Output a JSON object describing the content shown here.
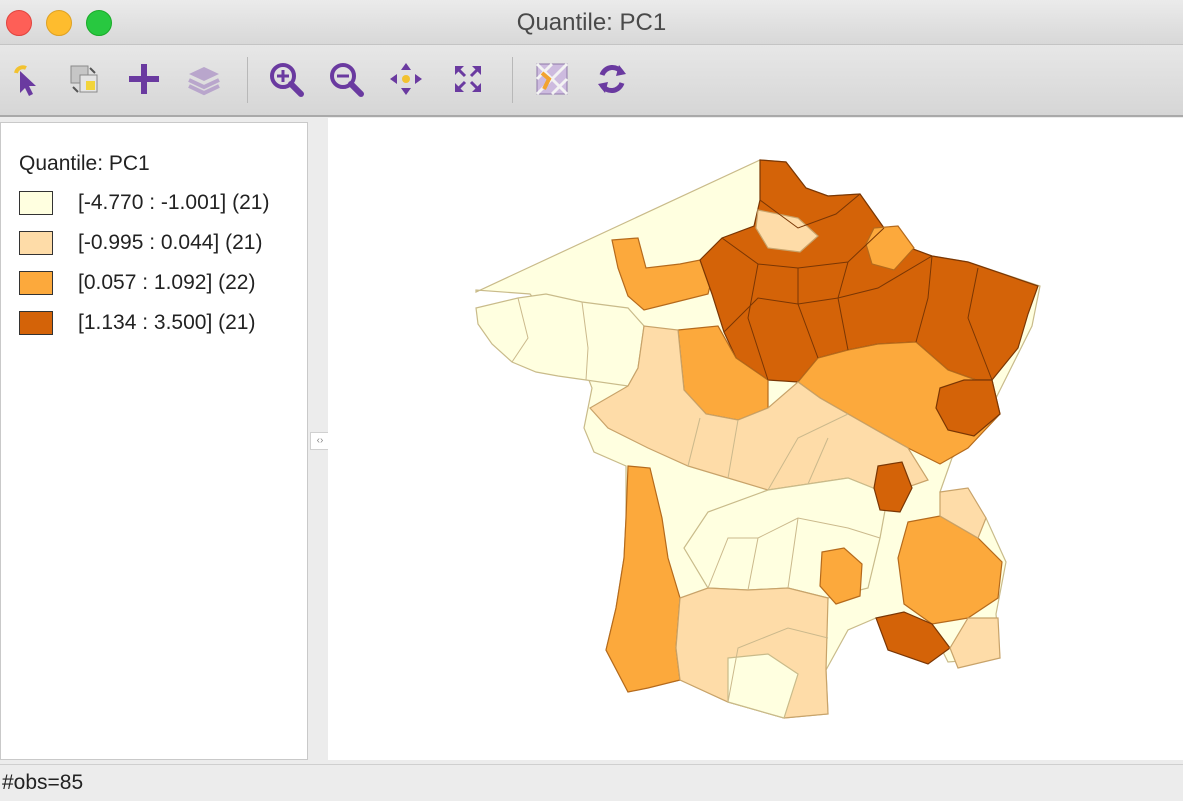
{
  "window": {
    "title": "Quantile: PC1"
  },
  "toolbar": {
    "tools": [
      {
        "name": "select-pointer-icon"
      },
      {
        "name": "copy-image-icon"
      },
      {
        "name": "add-layer-icon"
      },
      {
        "name": "layers-icon"
      },
      {
        "name": "zoom-in-icon"
      },
      {
        "name": "zoom-out-icon"
      },
      {
        "name": "pan-icon"
      },
      {
        "name": "full-extent-icon"
      },
      {
        "name": "toggle-basemap-icon"
      },
      {
        "name": "refresh-icon"
      }
    ]
  },
  "legend": {
    "title": "Quantile: PC1",
    "items": [
      {
        "label": "[-4.770 : -1.001] (21)",
        "color": "#ffffe0"
      },
      {
        "label": "[-0.995 : 0.044] (21)",
        "color": "#fedca8"
      },
      {
        "label": "[0.057 : 1.092] (22)",
        "color": "#fca93c"
      },
      {
        "label": "[1.134 : 3.500] (21)",
        "color": "#d46308"
      }
    ]
  },
  "colors": {
    "q1": "#ffffe0",
    "q2": "#fedca8",
    "q3": "#fca93c",
    "q4": "#d46308",
    "accent_purple": "#7f3fb1"
  },
  "status": {
    "text": "#obs=85"
  }
}
